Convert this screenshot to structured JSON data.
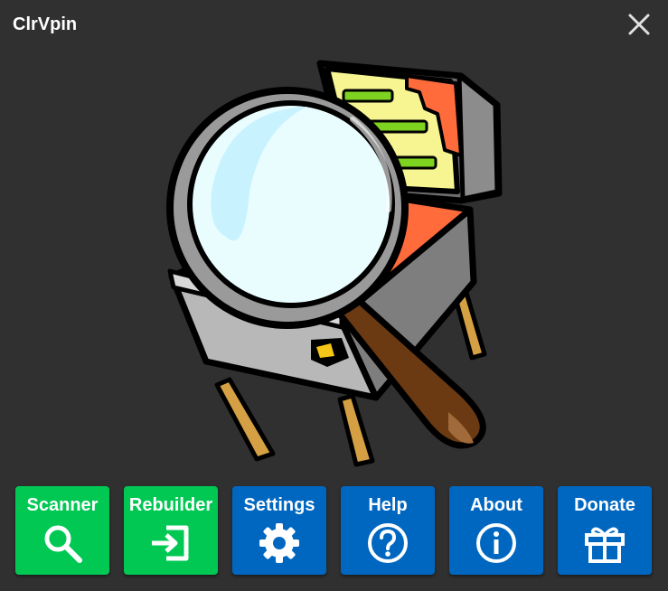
{
  "window": {
    "title": "ClrVpin"
  },
  "hero": {
    "icon": "pinball-machine-magnifier-icon"
  },
  "toolbar": {
    "buttons": [
      {
        "label": "Scanner",
        "icon": "search-icon",
        "color": "#00c853"
      },
      {
        "label": "Rebuilder",
        "icon": "login-icon",
        "color": "#00c853"
      },
      {
        "label": "Settings",
        "icon": "gear-icon",
        "color": "#0067c0"
      },
      {
        "label": "Help",
        "icon": "help-circle-icon",
        "color": "#0067c0"
      },
      {
        "label": "About",
        "icon": "info-circle-icon",
        "color": "#0067c0"
      },
      {
        "label": "Donate",
        "icon": "gift-icon",
        "color": "#0067c0"
      }
    ]
  },
  "colors": {
    "background": "#303030",
    "accent_green": "#00c853",
    "accent_blue": "#0067c0"
  }
}
